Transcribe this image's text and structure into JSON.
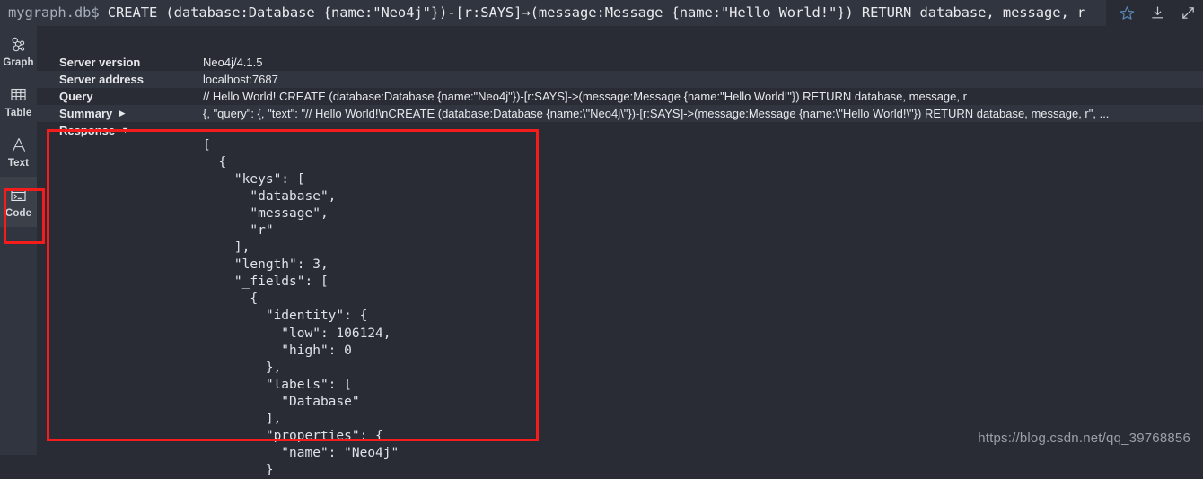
{
  "command_bar": {
    "prompt": "mygraph.db$",
    "query": "CREATE (database:Database {name:\"Neo4j\"})-[r:SAYS]→(message:Message {name:\"Hello World!\"}) RETURN database, message, r",
    "actions": [
      {
        "name": "favorite-star-icon",
        "label": "Favorite"
      },
      {
        "name": "download-icon",
        "label": "Download"
      },
      {
        "name": "expand-icon",
        "label": "Expand"
      }
    ]
  },
  "sidebar": {
    "items": [
      {
        "label": "Graph",
        "icon": "graph-icon",
        "selected": false
      },
      {
        "label": "Table",
        "icon": "table-icon",
        "selected": false
      },
      {
        "label": "Text",
        "icon": "text-icon",
        "selected": false
      },
      {
        "label": "Code",
        "icon": "code-icon",
        "selected": true
      }
    ]
  },
  "meta_rows": [
    {
      "key": "Server version",
      "value": "Neo4j/4.1.5",
      "toggle": ""
    },
    {
      "key": "Server address",
      "value": "localhost:7687",
      "toggle": ""
    },
    {
      "key": "Query",
      "value": "// Hello World! CREATE (database:Database {name:\"Neo4j\"})-[r:SAYS]->(message:Message {name:\"Hello World!\"}) RETURN database, message, r",
      "toggle": ""
    },
    {
      "key": "Summary",
      "value": "{, \"query\": {, \"text\": \"// Hello World!\\nCREATE (database:Database {name:\\\"Neo4j\\\"})-[r:SAYS]->(message:Message {name:\\\"Hello World!\\\"}) RETURN database, message, r\", ...",
      "toggle": "▶"
    },
    {
      "key": "Response",
      "value": "",
      "toggle": "▼"
    }
  ],
  "response_code": "[\n  {\n    \"keys\": [\n      \"database\",\n      \"message\",\n      \"r\"\n    ],\n    \"length\": 3,\n    \"_fields\": [\n      {\n        \"identity\": {\n          \"low\": 106124,\n          \"high\": 0\n        },\n        \"labels\": [\n          \"Database\"\n        ],\n        \"properties\": {\n          \"name\": \"Neo4j\"\n        }",
  "watermark": "https://blog.csdn.net/qq_39768856",
  "colors": {
    "background": "#292c35",
    "panel": "#31353f",
    "selected": "#3b4049",
    "text": "#e6e8eb",
    "annotation": "#f61c1c",
    "accent": "#5a87b8"
  }
}
